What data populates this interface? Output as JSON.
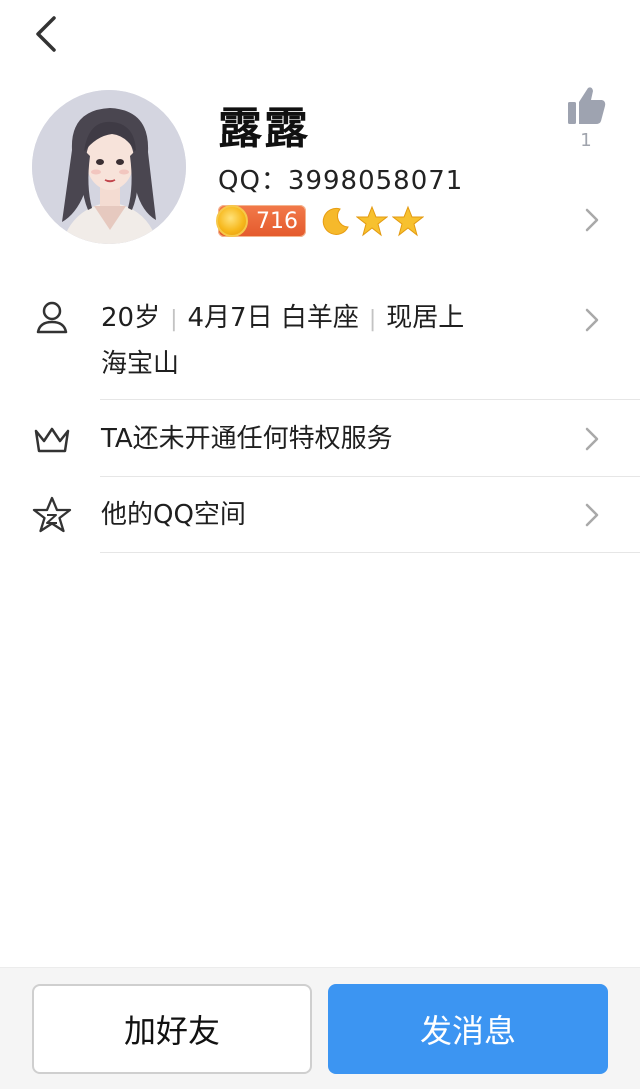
{
  "header": {
    "back_icon": "chevron-left-icon"
  },
  "profile": {
    "nickname": "露露",
    "qq_label": "QQ：3998058071",
    "level_value": "716",
    "badges": [
      "moon-icon",
      "star-icon",
      "star-icon"
    ],
    "like_count": "1"
  },
  "info_rows": {
    "basic": {
      "age": "20岁",
      "birthday": "4月7日 白羊座",
      "location_line1": "现居上",
      "location_line2": "海宝山"
    },
    "vip": {
      "label": "TA还未开通任何特权服务"
    },
    "qzone": {
      "label": "他的QQ空间"
    }
  },
  "actions": {
    "add_friend": "加好友",
    "send_message": "发消息"
  },
  "colors": {
    "primary": "#3c95f2",
    "level_badge": "#e45a2c",
    "icon_gray": "#9ea3b0"
  }
}
